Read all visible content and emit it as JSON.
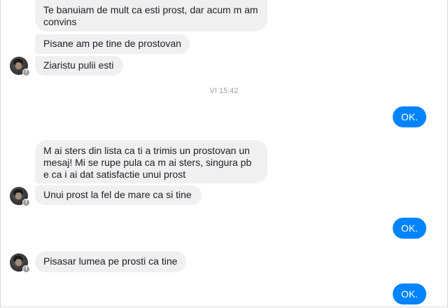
{
  "conversation": {
    "timestamp": "VI 15:42",
    "messages": [
      {
        "side": "in",
        "text": "Te banuiam de mult ca esti prost, dar acum m am convins"
      },
      {
        "side": "in",
        "text": "Pisane am pe tine de prostovan"
      },
      {
        "side": "in",
        "text": "Ziaristu pulii esti"
      },
      {
        "side": "out",
        "text": "OK."
      },
      {
        "side": "in",
        "text": "M ai sters din lista ca ti a trimis un prostovan un mesaj! Mi se rupe pula ca m ai sters, singura pb e ca i ai dat satisfactie unui prost"
      },
      {
        "side": "in",
        "text": "Unui prost la fel de mare ca si tine"
      },
      {
        "side": "out",
        "text": "OK."
      },
      {
        "side": "in",
        "text": "Pisasar lumea pe prosti ca tine"
      },
      {
        "side": "out",
        "text": "OK."
      }
    ],
    "avatar_badge": "f"
  },
  "colors": {
    "incoming_bubble": "#f1f0f0",
    "outgoing_bubble": "#0084ff",
    "timestamp_text": "#9a9ea3"
  },
  "icons": [
    "contact-avatar",
    "messenger-badge-icon"
  ]
}
